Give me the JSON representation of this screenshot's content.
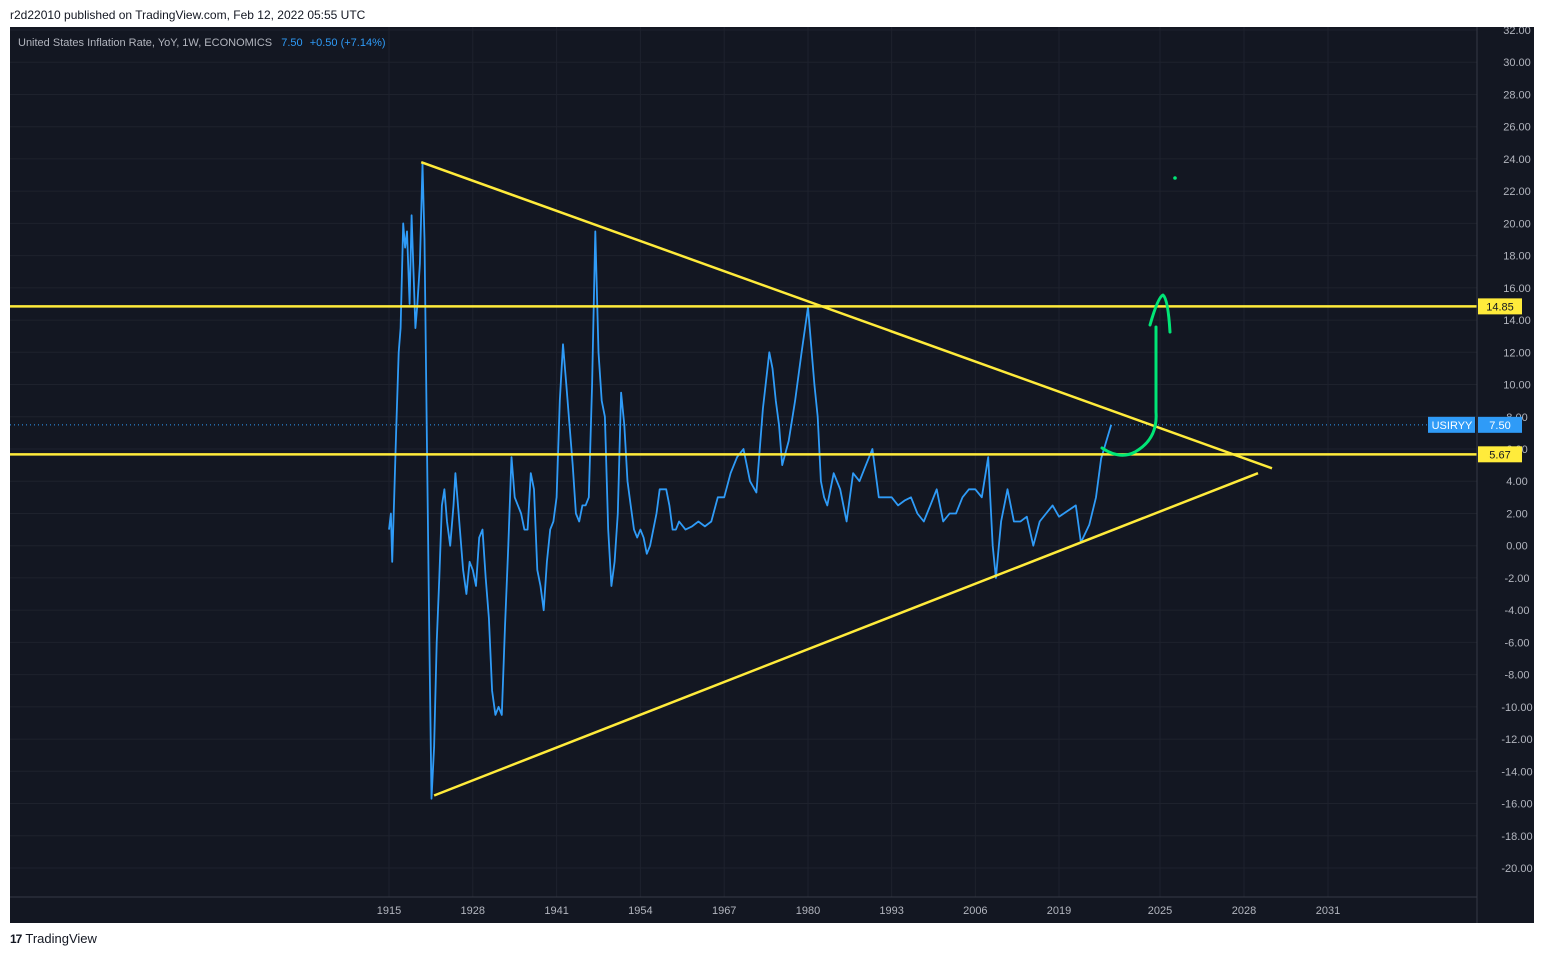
{
  "header": {
    "publisher": "r2d22010 published on TradingView.com, Feb 12, 2022 05:55 UTC"
  },
  "legend": {
    "title": "United States Inflation Rate, YoY, 1W, ECONOMICS",
    "last": "7.50",
    "change": "+0.50 (+7.14%)"
  },
  "footer": {
    "brand": "TradingView",
    "logo": "17"
  },
  "colors": {
    "background": "#131722",
    "grid": "#1e222d",
    "series": "#2f9bf7",
    "drawing": "#ffeb3b",
    "arrow": "#00e676",
    "axis_text": "#b2b5be"
  },
  "chart_data": {
    "type": "line",
    "title": "United States Inflation Rate, YoY, 1W, ECONOMICS",
    "xlabel": "",
    "ylabel": "",
    "x_ticks": [
      "1915",
      "1928",
      "1941",
      "1954",
      "1967",
      "1980",
      "1993",
      "2006",
      "2019",
      "2025",
      "2028",
      "2031"
    ],
    "y_ticks": [
      "32.00",
      "30.00",
      "28.00",
      "26.00",
      "24.00",
      "22.00",
      "20.00",
      "18.00",
      "16.00",
      "14.00",
      "12.00",
      "10.00",
      "8.00",
      "6.00",
      "4.00",
      "2.00",
      "0.00",
      "-2.00",
      "-4.00",
      "-6.00",
      "-8.00",
      "-10.00",
      "-12.00",
      "-14.00",
      "-16.00",
      "-18.00",
      "-20.00"
    ],
    "ylim": [
      -21.5,
      32
    ],
    "xlim": [
      1915,
      2031
    ],
    "grid": true,
    "series": [
      {
        "name": "USIRYY",
        "points": [
          [
            1915.0,
            1.0
          ],
          [
            1915.3,
            2.0
          ],
          [
            1915.5,
            -1.0
          ],
          [
            1915.8,
            3.0
          ],
          [
            1916.1,
            7.0
          ],
          [
            1916.5,
            12.0
          ],
          [
            1916.8,
            13.5
          ],
          [
            1917.2,
            20.0
          ],
          [
            1917.5,
            18.5
          ],
          [
            1917.8,
            19.5
          ],
          [
            1918.2,
            15.0
          ],
          [
            1918.5,
            20.5
          ],
          [
            1918.8,
            17.0
          ],
          [
            1919.1,
            13.5
          ],
          [
            1919.4,
            15.0
          ],
          [
            1919.8,
            17.5
          ],
          [
            1920.2,
            23.7
          ],
          [
            1920.5,
            19.0
          ],
          [
            1920.9,
            6.0
          ],
          [
            1921.3,
            -7.0
          ],
          [
            1921.6,
            -15.7
          ],
          [
            1922.0,
            -12.5
          ],
          [
            1922.4,
            -6.0
          ],
          [
            1922.8,
            -2.0
          ],
          [
            1923.2,
            2.5
          ],
          [
            1923.6,
            3.5
          ],
          [
            1924.0,
            1.5
          ],
          [
            1924.5,
            0.0
          ],
          [
            1925.0,
            2.5
          ],
          [
            1925.3,
            4.5
          ],
          [
            1925.7,
            2.5
          ],
          [
            1926.0,
            1.0
          ],
          [
            1926.5,
            -1.5
          ],
          [
            1927.0,
            -3.0
          ],
          [
            1927.5,
            -1.0
          ],
          [
            1928.0,
            -1.5
          ],
          [
            1928.5,
            -2.5
          ],
          [
            1929.0,
            0.5
          ],
          [
            1929.5,
            1.0
          ],
          [
            1930.0,
            -2.0
          ],
          [
            1930.5,
            -4.5
          ],
          [
            1931.0,
            -9.0
          ],
          [
            1931.5,
            -10.5
          ],
          [
            1932.0,
            -10.0
          ],
          [
            1932.5,
            -10.5
          ],
          [
            1933.0,
            -5.0
          ],
          [
            1933.5,
            0.0
          ],
          [
            1934.0,
            5.5
          ],
          [
            1934.5,
            3.0
          ],
          [
            1935.0,
            2.5
          ],
          [
            1935.5,
            2.0
          ],
          [
            1936.0,
            1.0
          ],
          [
            1936.5,
            1.0
          ],
          [
            1937.0,
            4.5
          ],
          [
            1937.5,
            3.5
          ],
          [
            1938.0,
            -1.5
          ],
          [
            1938.5,
            -2.5
          ],
          [
            1939.0,
            -4.0
          ],
          [
            1939.5,
            -1.0
          ],
          [
            1940.0,
            1.0
          ],
          [
            1940.5,
            1.5
          ],
          [
            1941.0,
            3.0
          ],
          [
            1941.5,
            9.0
          ],
          [
            1942.0,
            12.5
          ],
          [
            1942.5,
            10.0
          ],
          [
            1943.0,
            7.5
          ],
          [
            1943.5,
            5.0
          ],
          [
            1944.0,
            2.0
          ],
          [
            1944.5,
            1.5
          ],
          [
            1945.0,
            2.5
          ],
          [
            1945.5,
            2.5
          ],
          [
            1946.0,
            3.0
          ],
          [
            1946.5,
            10.0
          ],
          [
            1947.0,
            19.5
          ],
          [
            1947.5,
            12.0
          ],
          [
            1948.0,
            9.0
          ],
          [
            1948.5,
            8.0
          ],
          [
            1949.0,
            1.0
          ],
          [
            1949.5,
            -2.5
          ],
          [
            1950.0,
            -1.0
          ],
          [
            1950.5,
            2.0
          ],
          [
            1951.0,
            9.5
          ],
          [
            1951.5,
            7.5
          ],
          [
            1952.0,
            4.0
          ],
          [
            1952.5,
            2.5
          ],
          [
            1953.0,
            1.0
          ],
          [
            1953.5,
            0.5
          ],
          [
            1954.0,
            1.0
          ],
          [
            1954.5,
            0.5
          ],
          [
            1955.0,
            -0.5
          ],
          [
            1955.5,
            0.0
          ],
          [
            1956.0,
            1.0
          ],
          [
            1956.5,
            2.0
          ],
          [
            1957.0,
            3.5
          ],
          [
            1957.5,
            3.5
          ],
          [
            1958.0,
            3.5
          ],
          [
            1958.5,
            2.5
          ],
          [
            1959.0,
            1.0
          ],
          [
            1959.5,
            1.0
          ],
          [
            1960.0,
            1.5
          ],
          [
            1961.0,
            1.0
          ],
          [
            1962.0,
            1.2
          ],
          [
            1963.0,
            1.5
          ],
          [
            1964.0,
            1.2
          ],
          [
            1965.0,
            1.5
          ],
          [
            1966.0,
            3.0
          ],
          [
            1967.0,
            3.0
          ],
          [
            1968.0,
            4.5
          ],
          [
            1969.0,
            5.5
          ],
          [
            1970.0,
            6.0
          ],
          [
            1971.0,
            4.0
          ],
          [
            1972.0,
            3.3
          ],
          [
            1973.0,
            8.5
          ],
          [
            1974.0,
            12.0
          ],
          [
            1974.5,
            11.0
          ],
          [
            1975.0,
            9.0
          ],
          [
            1975.5,
            7.5
          ],
          [
            1976.0,
            5.0
          ],
          [
            1977.0,
            6.5
          ],
          [
            1978.0,
            9.0
          ],
          [
            1979.0,
            12.0
          ],
          [
            1980.0,
            14.8
          ],
          [
            1981.0,
            10.0
          ],
          [
            1981.5,
            8.0
          ],
          [
            1982.0,
            4.0
          ],
          [
            1982.5,
            3.0
          ],
          [
            1983.0,
            2.5
          ],
          [
            1984.0,
            4.5
          ],
          [
            1985.0,
            3.5
          ],
          [
            1986.0,
            1.5
          ],
          [
            1987.0,
            4.5
          ],
          [
            1988.0,
            4.0
          ],
          [
            1989.0,
            5.0
          ],
          [
            1990.0,
            6.0
          ],
          [
            1991.0,
            3.0
          ],
          [
            1992.0,
            3.0
          ],
          [
            1993.0,
            3.0
          ],
          [
            1994.0,
            2.5
          ],
          [
            1995.0,
            2.8
          ],
          [
            1996.0,
            3.0
          ],
          [
            1997.0,
            2.0
          ],
          [
            1998.0,
            1.5
          ],
          [
            1999.0,
            2.5
          ],
          [
            2000.0,
            3.5
          ],
          [
            2001.0,
            1.5
          ],
          [
            2002.0,
            2.0
          ],
          [
            2003.0,
            2.0
          ],
          [
            2004.0,
            3.0
          ],
          [
            2005.0,
            3.5
          ],
          [
            2006.0,
            3.5
          ],
          [
            2007.0,
            3.0
          ],
          [
            2008.0,
            5.5
          ],
          [
            2008.7,
            0.0
          ],
          [
            2009.2,
            -2.0
          ],
          [
            2010.0,
            1.5
          ],
          [
            2011.0,
            3.5
          ],
          [
            2012.0,
            1.5
          ],
          [
            2013.0,
            1.5
          ],
          [
            2014.0,
            1.8
          ],
          [
            2015.0,
            0.0
          ],
          [
            2016.0,
            1.5
          ],
          [
            2017.0,
            2.0
          ],
          [
            2018.0,
            2.5
          ],
          [
            2019.0,
            1.8
          ],
          [
            2020.0,
            2.5
          ],
          [
            2020.3,
            0.2
          ],
          [
            2020.8,
            1.3
          ],
          [
            2021.2,
            3.0
          ],
          [
            2021.5,
            5.4
          ],
          [
            2022.1,
            7.5
          ]
        ]
      }
    ],
    "lines": [
      {
        "type": "horizontal",
        "y": 14.85,
        "label": "14.85"
      },
      {
        "type": "horizontal",
        "y": 5.67,
        "label": "5.67"
      },
      {
        "type": "trend",
        "from": [
          1920.0,
          23.8
        ],
        "to": [
          2029.0,
          4.8
        ]
      },
      {
        "type": "trend",
        "from": [
          1922.0,
          -15.5
        ],
        "to": [
          2028.5,
          4.5
        ]
      }
    ],
    "current": {
      "label": "USIRYY",
      "value": "7.50",
      "y": 7.5
    }
  }
}
